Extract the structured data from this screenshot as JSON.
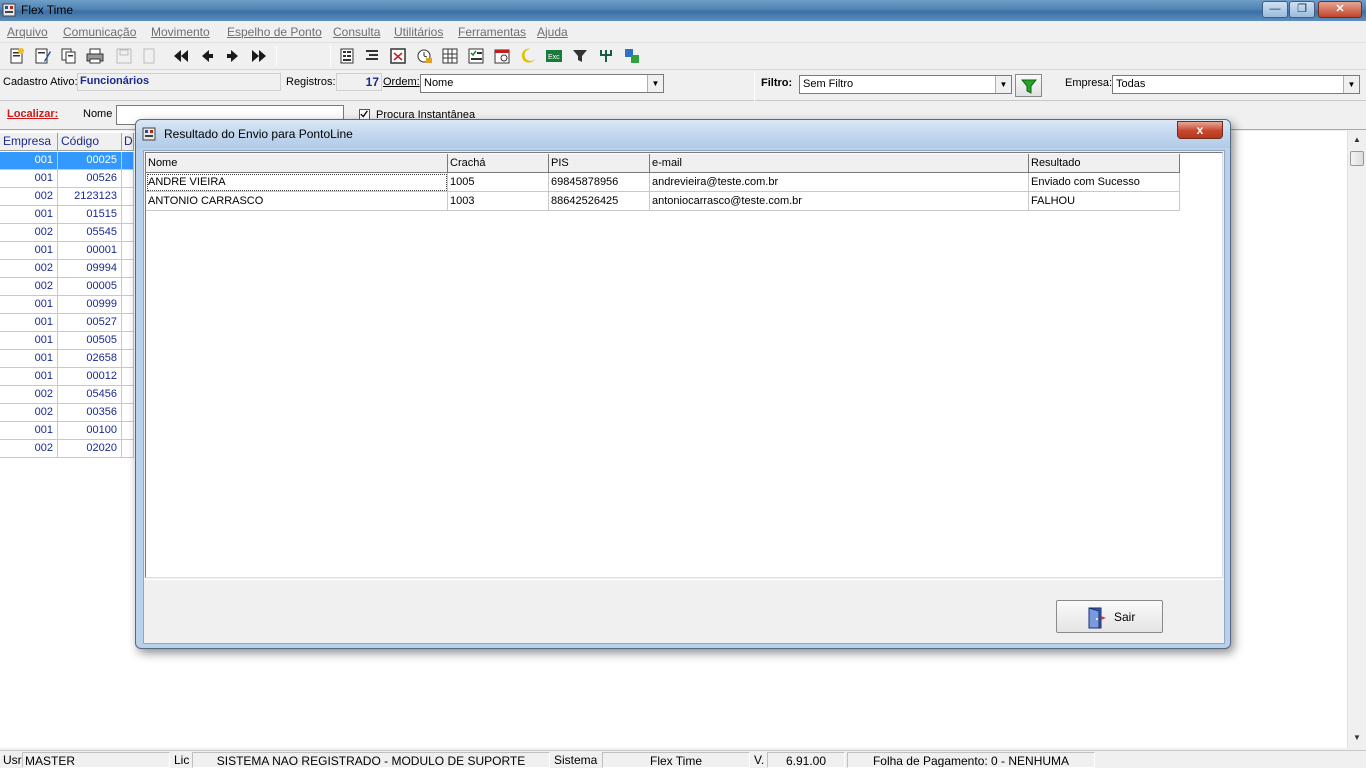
{
  "window": {
    "title": "Flex Time"
  },
  "menu": [
    "Arquivo",
    "Comunicação",
    "Movimento",
    "Espelho de Ponto",
    "Consulta",
    "Utilitários",
    "Ferramentas",
    "Ajuda"
  ],
  "toolbar_icons": [
    "new-record-icon",
    "edit-record-icon",
    "copy-record-icon",
    "print-icon",
    "save-icon",
    "cancel-icon",
    "first-record-icon",
    "previous-record-icon",
    "next-record-icon",
    "last-record-icon",
    "report-icon",
    "list-icon",
    "calendar-icon",
    "clock-icon",
    "grid-icon",
    "checklist-icon",
    "schedule-icon",
    "moon-icon",
    "export-icon",
    "filter-icon",
    "network-icon",
    "transfer-icon"
  ],
  "info": {
    "cadastro_label": "Cadastro Ativo:",
    "cadastro_value": "Funcionários",
    "registros_label": "Registros:",
    "registros_value": "17",
    "ordem_label": "Ordem:",
    "ordem_value": "Nome",
    "filtro_label": "Filtro:",
    "filtro_value": "Sem Filtro",
    "empresa_label": "Empresa:",
    "empresa_value": "Todas"
  },
  "localizar": {
    "label": "Localizar:",
    "field_label": "Nome",
    "search_value": "",
    "checkbox_label": "Procura Instantânea",
    "checked": true
  },
  "left_grid": {
    "columns": [
      "Empresa",
      "Código",
      "D"
    ],
    "rows": [
      [
        "001",
        "00025"
      ],
      [
        "001",
        "00526"
      ],
      [
        "002",
        "2123123"
      ],
      [
        "001",
        "01515"
      ],
      [
        "002",
        "05545"
      ],
      [
        "001",
        "00001"
      ],
      [
        "002",
        "09994"
      ],
      [
        "002",
        "00005"
      ],
      [
        "001",
        "00999"
      ],
      [
        "001",
        "00527"
      ],
      [
        "001",
        "00505"
      ],
      [
        "001",
        "02658"
      ],
      [
        "001",
        "00012"
      ],
      [
        "002",
        "05456"
      ],
      [
        "002",
        "00356"
      ],
      [
        "001",
        "00100"
      ],
      [
        "002",
        "02020"
      ]
    ]
  },
  "dialog": {
    "title": "Resultado do Envio para PontoLine",
    "close_label": "x",
    "columns": [
      "Nome",
      "Crachá",
      "PIS",
      "e-mail",
      "Resultado"
    ],
    "rows": [
      [
        "ANDRE VIEIRA",
        "1005",
        "69845878956",
        "andrevieira@teste.com.br",
        "Enviado com Sucesso"
      ],
      [
        "ANTONIO CARRASCO",
        "1003",
        "88642526425",
        "antoniocarrasco@teste.com.br",
        "FALHOU"
      ]
    ],
    "exit_label": "Sair"
  },
  "status": {
    "usr_label": "Usr",
    "usr_value": "MASTER",
    "lic_label": "Lic",
    "lic_value": "SISTEMA NAO REGISTRADO - MODULO DE SUPORTE",
    "sistema_label": "Sistema",
    "sistema_value": "Flex Time",
    "version_label": "V.",
    "version_value": "6.91.00",
    "folha_value": "Folha de Pagamento: 0 - NENHUMA"
  }
}
